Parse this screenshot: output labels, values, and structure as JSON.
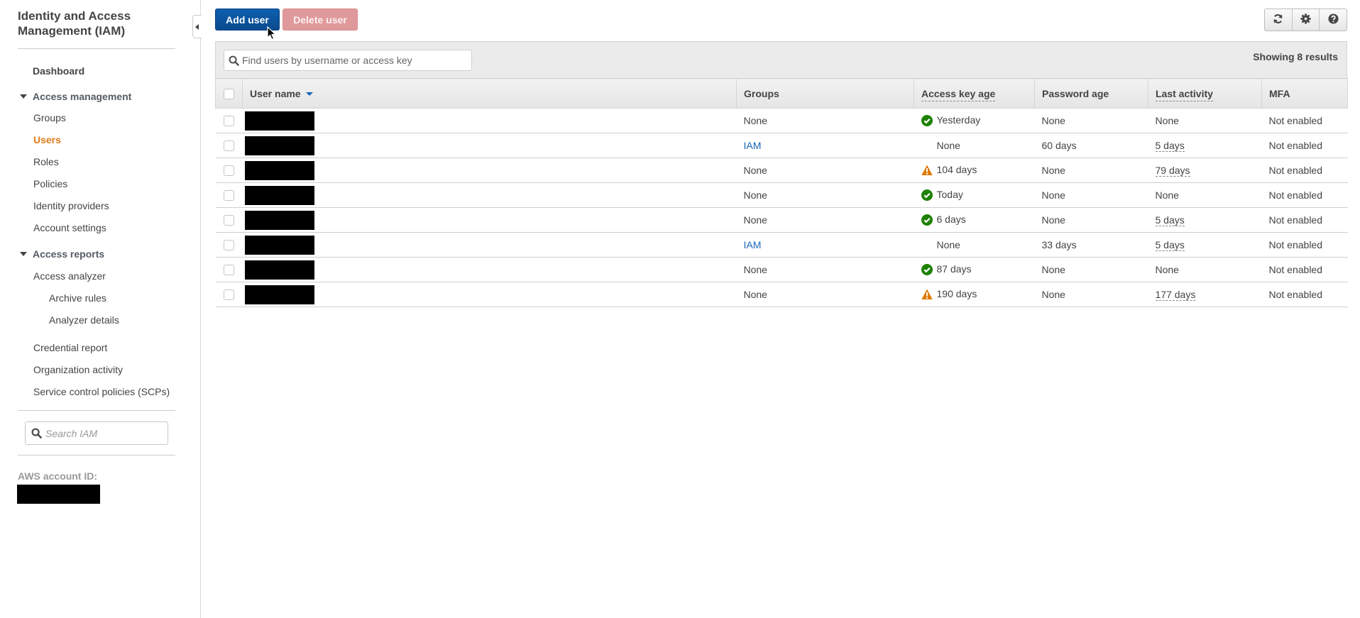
{
  "sidebar": {
    "title": "Identity and Access Management (IAM)",
    "dashboard": "Dashboard",
    "sections": [
      {
        "label": "Access management",
        "items": [
          "Groups",
          "Users",
          "Roles",
          "Policies",
          "Identity providers",
          "Account settings"
        ],
        "active": "Users"
      },
      {
        "label": "Access reports",
        "items": [
          "Access analyzer",
          "Archive rules",
          "Analyzer details",
          "Credential report",
          "Organization activity",
          "Service control policies (SCPs)"
        ]
      }
    ],
    "search_placeholder": "Search IAM",
    "account_id_label": "AWS account ID:",
    "account_id_value": "[redacted]"
  },
  "toolbar": {
    "add_user_label": "Add user",
    "delete_user_label": "Delete user",
    "icons": [
      "refresh-icon",
      "gear-icon",
      "help-icon"
    ]
  },
  "filter": {
    "placeholder": "Find users by username or access key",
    "value": ""
  },
  "results_text": "Showing 8 results",
  "table": {
    "columns": [
      "User name",
      "Groups",
      "Access key age",
      "Password age",
      "Last activity",
      "MFA"
    ],
    "sorted_by": "User name",
    "rows": [
      {
        "user": "[redacted]",
        "groups": "None",
        "groups_link": false,
        "key_status": "ok",
        "key_age": "Yesterday",
        "password_age": "None",
        "last_activity": "None",
        "last_activity_link": false,
        "mfa": "Not enabled"
      },
      {
        "user": "[redacted]",
        "groups": "IAM",
        "groups_link": true,
        "key_status": "none",
        "key_age": "None",
        "password_age": "60 days",
        "last_activity": "5 days",
        "last_activity_link": true,
        "mfa": "Not enabled"
      },
      {
        "user": "[redacted]",
        "groups": "None",
        "groups_link": false,
        "key_status": "warning",
        "key_age": "104 days",
        "password_age": "None",
        "last_activity": "79 days",
        "last_activity_link": true,
        "mfa": "Not enabled"
      },
      {
        "user": "[redacted]",
        "groups": "None",
        "groups_link": false,
        "key_status": "ok",
        "key_age": "Today",
        "password_age": "None",
        "last_activity": "None",
        "last_activity_link": false,
        "mfa": "Not enabled"
      },
      {
        "user": "[redacted]",
        "groups": "None",
        "groups_link": false,
        "key_status": "ok",
        "key_age": "6 days",
        "password_age": "None",
        "last_activity": "5 days",
        "last_activity_link": true,
        "mfa": "Not enabled"
      },
      {
        "user": "[redacted]",
        "groups": "IAM",
        "groups_link": true,
        "key_status": "none",
        "key_age": "None",
        "password_age": "33 days",
        "last_activity": "5 days",
        "last_activity_link": true,
        "mfa": "Not enabled"
      },
      {
        "user": "[redacted]",
        "groups": "None",
        "groups_link": false,
        "key_status": "ok",
        "key_age": "87 days",
        "password_age": "None",
        "last_activity": "None",
        "last_activity_link": false,
        "mfa": "Not enabled"
      },
      {
        "user": "[redacted]",
        "groups": "None",
        "groups_link": false,
        "key_status": "warning",
        "key_age": "190 days",
        "password_age": "None",
        "last_activity": "177 days",
        "last_activity_link": true,
        "mfa": "Not enabled"
      }
    ]
  },
  "colors": {
    "primary": "#0a4a8e",
    "danger_disabled": "#e0999b",
    "active_nav": "#e07b1a",
    "link": "#1866b7",
    "ok": "#1d8102",
    "warning": "#e07b00"
  }
}
